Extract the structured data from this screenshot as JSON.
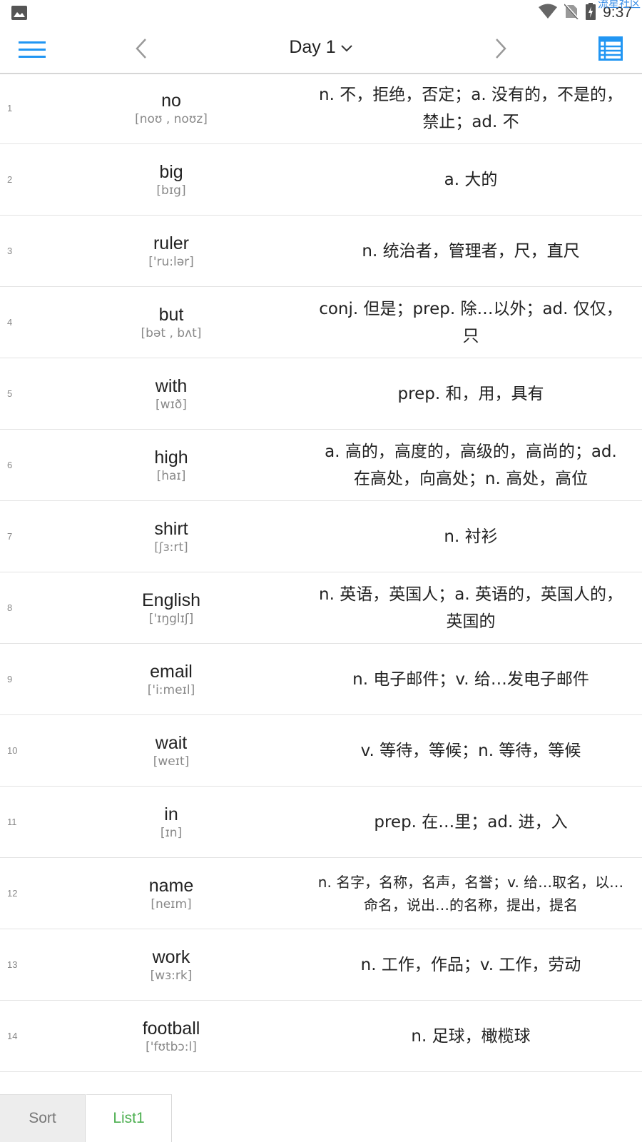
{
  "status_bar": {
    "time": "9:37",
    "watermark": "流星社区",
    "icons": [
      "image-icon",
      "wifi-icon",
      "no-sim-icon",
      "battery-charging-icon"
    ]
  },
  "header": {
    "title": "Day 1",
    "icons": [
      "menu-icon",
      "chevron-left-icon",
      "chevron-down-icon",
      "chevron-right-icon",
      "list-view-icon"
    ],
    "accent_color": "#2196f3"
  },
  "words": [
    {
      "index": "1",
      "word": "no",
      "phonetic": "[noʊ , noʊz]",
      "definition": "n. 不，拒绝，否定；a. 没有的，不是的，禁止；ad. 不"
    },
    {
      "index": "2",
      "word": "big",
      "phonetic": "[bɪg]",
      "definition": "a. 大的"
    },
    {
      "index": "3",
      "word": "ruler",
      "phonetic": "['ru:lər]",
      "definition": "n. 统治者，管理者，尺，直尺"
    },
    {
      "index": "4",
      "word": "but",
      "phonetic": "[bət , bʌt]",
      "definition": "conj. 但是；prep. 除…以外；ad. 仅仅，只"
    },
    {
      "index": "5",
      "word": "with",
      "phonetic": "[wɪð]",
      "definition": "prep. 和，用，具有"
    },
    {
      "index": "6",
      "word": "high",
      "phonetic": "[haɪ]",
      "definition": "a. 高的，高度的，高级的，高尚的；ad. 在高处，向高处；n. 高处，高位"
    },
    {
      "index": "7",
      "word": "shirt",
      "phonetic": "[ʃɜ:rt]",
      "definition": "n. 衬衫"
    },
    {
      "index": "8",
      "word": "English",
      "phonetic": "['ɪŋglɪʃ]",
      "definition": "n. 英语，英国人；a. 英语的，英国人的，英国的"
    },
    {
      "index": "9",
      "word": "email",
      "phonetic": "['i:meɪl]",
      "definition": "n. 电子邮件；v. 给…发电子邮件"
    },
    {
      "index": "10",
      "word": "wait",
      "phonetic": "[weɪt]",
      "definition": "v. 等待，等候；n. 等待，等候"
    },
    {
      "index": "11",
      "word": "in",
      "phonetic": "[ɪn]",
      "definition": "prep. 在…里；ad. 进，入"
    },
    {
      "index": "12",
      "word": "name",
      "phonetic": "[neɪm]",
      "definition": "n. 名字，名称，名声，名誉；v. 给…取名，以…命名，说出…的名称，提出，提名"
    },
    {
      "index": "13",
      "word": "work",
      "phonetic": "[wɜ:rk]",
      "definition": "n. 工作，作品；v. 工作，劳动"
    },
    {
      "index": "14",
      "word": "football",
      "phonetic": "['fʊtbɔ:l]",
      "definition": "n. 足球，橄榄球"
    }
  ],
  "tabs": [
    {
      "label": "Sort",
      "active": false
    },
    {
      "label": "List1",
      "active": true,
      "color": "#4caf50"
    }
  ]
}
